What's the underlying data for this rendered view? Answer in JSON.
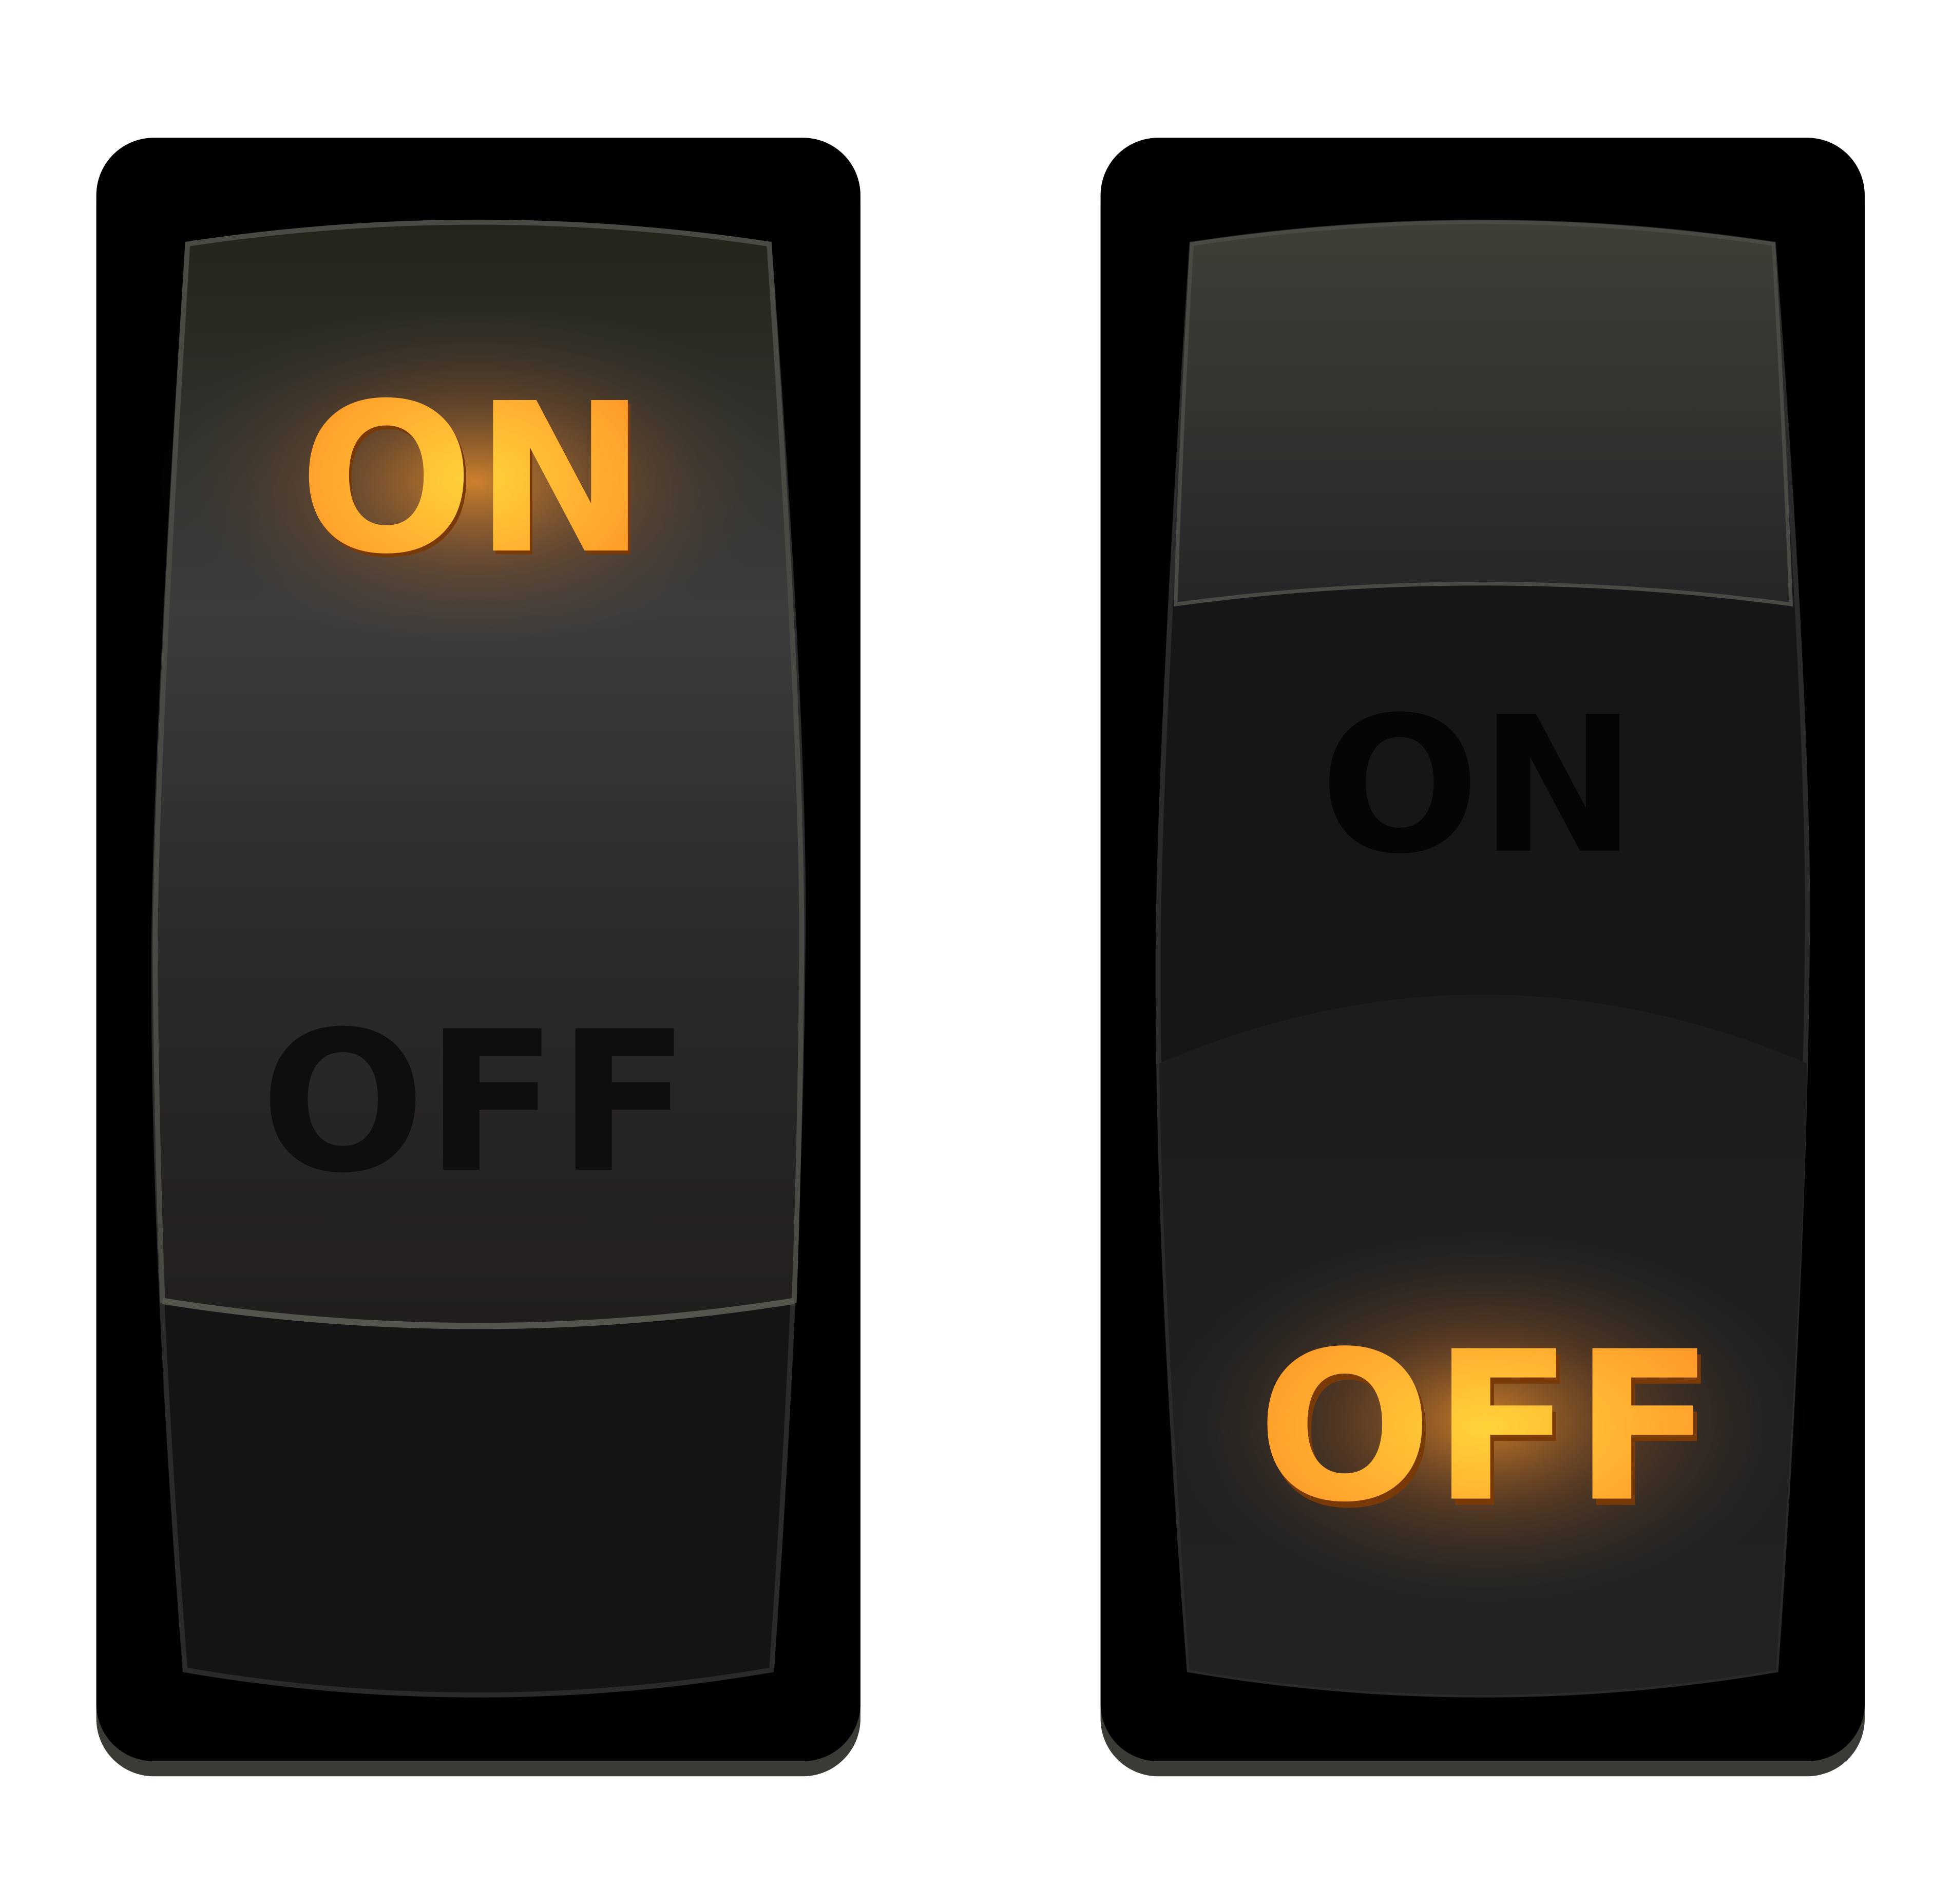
{
  "switches": [
    {
      "on_label": "ON",
      "off_label": "OFF",
      "state": "on"
    },
    {
      "on_label": "ON",
      "off_label": "OFF",
      "state": "off"
    }
  ],
  "colors": {
    "lit": "#ffa52a",
    "lit_core": "#ffcf3a",
    "unlit": "#0e0e0e",
    "housing": "#000000",
    "background": "#ffffff"
  }
}
